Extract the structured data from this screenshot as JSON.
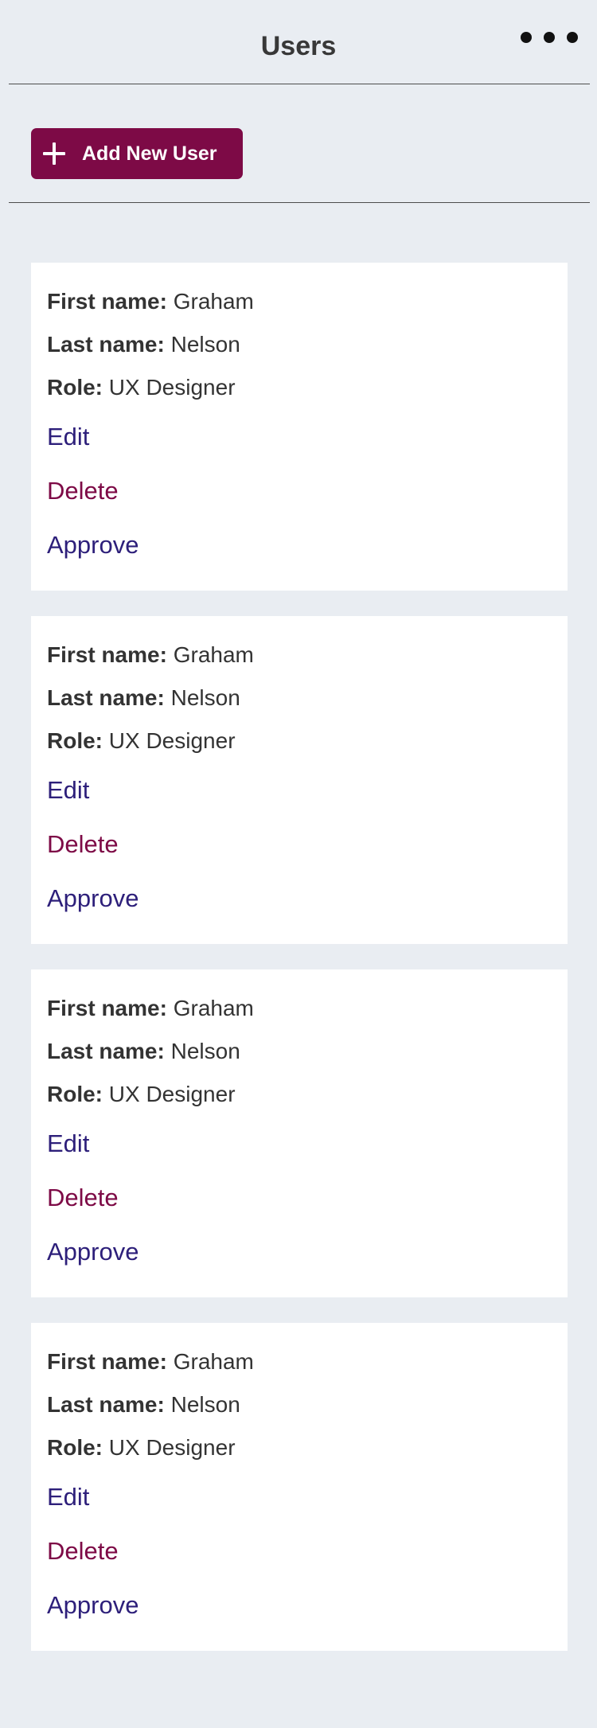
{
  "header": {
    "title": "Users",
    "more_icon": "more-horizontal-icon"
  },
  "toolbar": {
    "add_label": "Add New User",
    "add_icon": "plus-icon"
  },
  "colors": {
    "background": "#e9edf2",
    "primary_button": "#7d0a46",
    "link_primary": "#2d1f7a",
    "link_danger": "#7d0a46",
    "card": "#ffffff"
  },
  "users": [
    {
      "first_label": "First name:",
      "first_value": "Graham",
      "last_label": "Last name:",
      "last_value": "Nelson",
      "role_label": "Role:",
      "role_value": "UX Designer",
      "edit": "Edit",
      "delete": "Delete",
      "approve": "Approve"
    },
    {
      "first_label": "First name:",
      "first_value": "Graham",
      "last_label": "Last name:",
      "last_value": "Nelson",
      "role_label": "Role:",
      "role_value": "UX Designer",
      "edit": "Edit",
      "delete": "Delete",
      "approve": "Approve"
    },
    {
      "first_label": "First name:",
      "first_value": "Graham",
      "last_label": "Last name:",
      "last_value": "Nelson",
      "role_label": "Role:",
      "role_value": "UX Designer",
      "edit": "Edit",
      "delete": "Delete",
      "approve": "Approve"
    },
    {
      "first_label": "First name:",
      "first_value": "Graham",
      "last_label": "Last name:",
      "last_value": "Nelson",
      "role_label": "Role:",
      "role_value": "UX Designer",
      "edit": "Edit",
      "delete": "Delete",
      "approve": "Approve"
    }
  ]
}
